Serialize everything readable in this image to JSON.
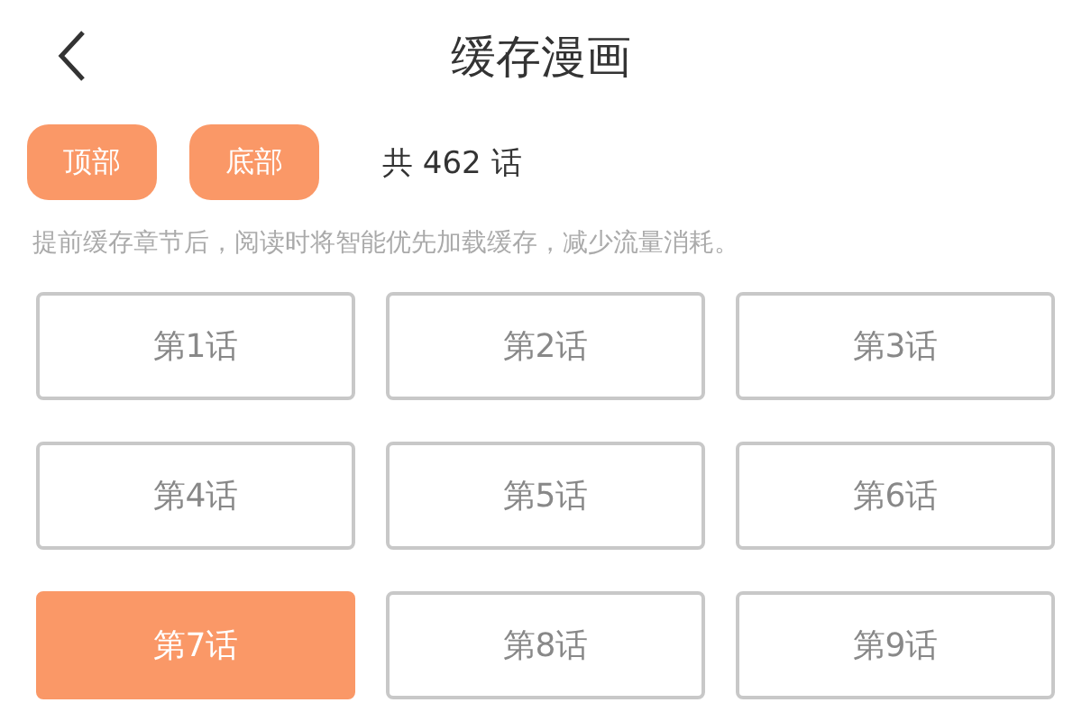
{
  "header": {
    "title": "缓存漫画"
  },
  "toolbar": {
    "buttons": [
      "顶部",
      "底部"
    ],
    "count": "共 462 话"
  },
  "hint": "提前缓存章节后，阅读时将智能优先加载缓存，减少流量消耗。",
  "chapters": [
    {
      "label": "第1话",
      "selected": false
    },
    {
      "label": "第2话",
      "selected": false
    },
    {
      "label": "第3话",
      "selected": false
    },
    {
      "label": "第4话",
      "selected": false
    },
    {
      "label": "第5话",
      "selected": false
    },
    {
      "label": "第6话",
      "selected": false
    },
    {
      "label": "第7话",
      "selected": true
    },
    {
      "label": "第8话",
      "selected": false
    },
    {
      "label": "第9话",
      "selected": false
    }
  ]
}
